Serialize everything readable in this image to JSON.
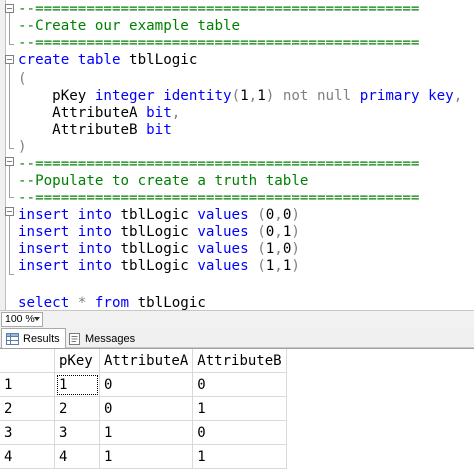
{
  "editor": {
    "lines": [
      [
        {
          "t": "--=============================================",
          "c": "cm"
        }
      ],
      [
        {
          "t": "--Create our example table",
          "c": "cm"
        }
      ],
      [
        {
          "t": "--=============================================",
          "c": "cm"
        }
      ],
      [
        {
          "t": "create",
          "c": "kw"
        },
        {
          "t": " ",
          "c": ""
        },
        {
          "t": "table",
          "c": "kw"
        },
        {
          "t": " tblLogic",
          "c": ""
        }
      ],
      [
        {
          "t": "(",
          "c": "gr"
        }
      ],
      [
        {
          "t": "    pKey ",
          "c": ""
        },
        {
          "t": "integer",
          "c": "kw"
        },
        {
          "t": " ",
          "c": ""
        },
        {
          "t": "identity",
          "c": "kw"
        },
        {
          "t": "(",
          "c": "gr"
        },
        {
          "t": "1",
          "c": ""
        },
        {
          "t": ",",
          "c": "gr"
        },
        {
          "t": "1",
          "c": ""
        },
        {
          "t": ")",
          "c": "gr"
        },
        {
          "t": " ",
          "c": ""
        },
        {
          "t": "not null",
          "c": "gr"
        },
        {
          "t": " ",
          "c": ""
        },
        {
          "t": "primary key",
          "c": "kw"
        },
        {
          "t": ",",
          "c": "gr"
        }
      ],
      [
        {
          "t": "    AttributeA ",
          "c": ""
        },
        {
          "t": "bit",
          "c": "kw"
        },
        {
          "t": ",",
          "c": "gr"
        }
      ],
      [
        {
          "t": "    AttributeB ",
          "c": ""
        },
        {
          "t": "bit",
          "c": "kw"
        }
      ],
      [
        {
          "t": ")",
          "c": "gr"
        }
      ],
      [
        {
          "t": "--=============================================",
          "c": "cm"
        }
      ],
      [
        {
          "t": "--Populate to create a truth table",
          "c": "cm"
        }
      ],
      [
        {
          "t": "--=============================================",
          "c": "cm"
        }
      ],
      [
        {
          "t": "insert",
          "c": "kw"
        },
        {
          "t": " ",
          "c": ""
        },
        {
          "t": "into",
          "c": "kw"
        },
        {
          "t": " tblLogic ",
          "c": ""
        },
        {
          "t": "values",
          "c": "kw"
        },
        {
          "t": " ",
          "c": ""
        },
        {
          "t": "(",
          "c": "gr"
        },
        {
          "t": "0",
          "c": ""
        },
        {
          "t": ",",
          "c": "gr"
        },
        {
          "t": "0",
          "c": ""
        },
        {
          "t": ")",
          "c": "gr"
        }
      ],
      [
        {
          "t": "insert",
          "c": "kw"
        },
        {
          "t": " ",
          "c": ""
        },
        {
          "t": "into",
          "c": "kw"
        },
        {
          "t": " tblLogic ",
          "c": ""
        },
        {
          "t": "values",
          "c": "kw"
        },
        {
          "t": " ",
          "c": ""
        },
        {
          "t": "(",
          "c": "gr"
        },
        {
          "t": "0",
          "c": ""
        },
        {
          "t": ",",
          "c": "gr"
        },
        {
          "t": "1",
          "c": ""
        },
        {
          "t": ")",
          "c": "gr"
        }
      ],
      [
        {
          "t": "insert",
          "c": "kw"
        },
        {
          "t": " ",
          "c": ""
        },
        {
          "t": "into",
          "c": "kw"
        },
        {
          "t": " tblLogic ",
          "c": ""
        },
        {
          "t": "values",
          "c": "kw"
        },
        {
          "t": " ",
          "c": ""
        },
        {
          "t": "(",
          "c": "gr"
        },
        {
          "t": "1",
          "c": ""
        },
        {
          "t": ",",
          "c": "gr"
        },
        {
          "t": "0",
          "c": ""
        },
        {
          "t": ")",
          "c": "gr"
        }
      ],
      [
        {
          "t": "insert",
          "c": "kw"
        },
        {
          "t": " ",
          "c": ""
        },
        {
          "t": "into",
          "c": "kw"
        },
        {
          "t": " tblLogic ",
          "c": ""
        },
        {
          "t": "values",
          "c": "kw"
        },
        {
          "t": " ",
          "c": ""
        },
        {
          "t": "(",
          "c": "gr"
        },
        {
          "t": "1",
          "c": ""
        },
        {
          "t": ",",
          "c": "gr"
        },
        {
          "t": "1",
          "c": ""
        },
        {
          "t": ")",
          "c": "gr"
        }
      ],
      [
        {
          "t": "",
          "c": ""
        }
      ],
      [
        {
          "t": "select",
          "c": "kw"
        },
        {
          "t": " ",
          "c": ""
        },
        {
          "t": "*",
          "c": "gr"
        },
        {
          "t": " ",
          "c": ""
        },
        {
          "t": "from",
          "c": "kw"
        },
        {
          "t": " tblLogic",
          "c": ""
        }
      ]
    ]
  },
  "zoom": {
    "value": "100 %"
  },
  "tabs": [
    {
      "label": "Results",
      "active": true
    },
    {
      "label": "Messages",
      "active": false
    }
  ],
  "results": {
    "columns": [
      "pKey",
      "AttributeA",
      "AttributeB"
    ],
    "rows": [
      {
        "num": "1",
        "cells": [
          "1",
          "0",
          "0"
        ]
      },
      {
        "num": "2",
        "cells": [
          "2",
          "0",
          "1"
        ]
      },
      {
        "num": "3",
        "cells": [
          "3",
          "1",
          "0"
        ]
      },
      {
        "num": "4",
        "cells": [
          "4",
          "1",
          "1"
        ]
      }
    ]
  },
  "colors": {
    "keyword": "#0000ff",
    "comment": "#008000",
    "operator": "#808080"
  }
}
